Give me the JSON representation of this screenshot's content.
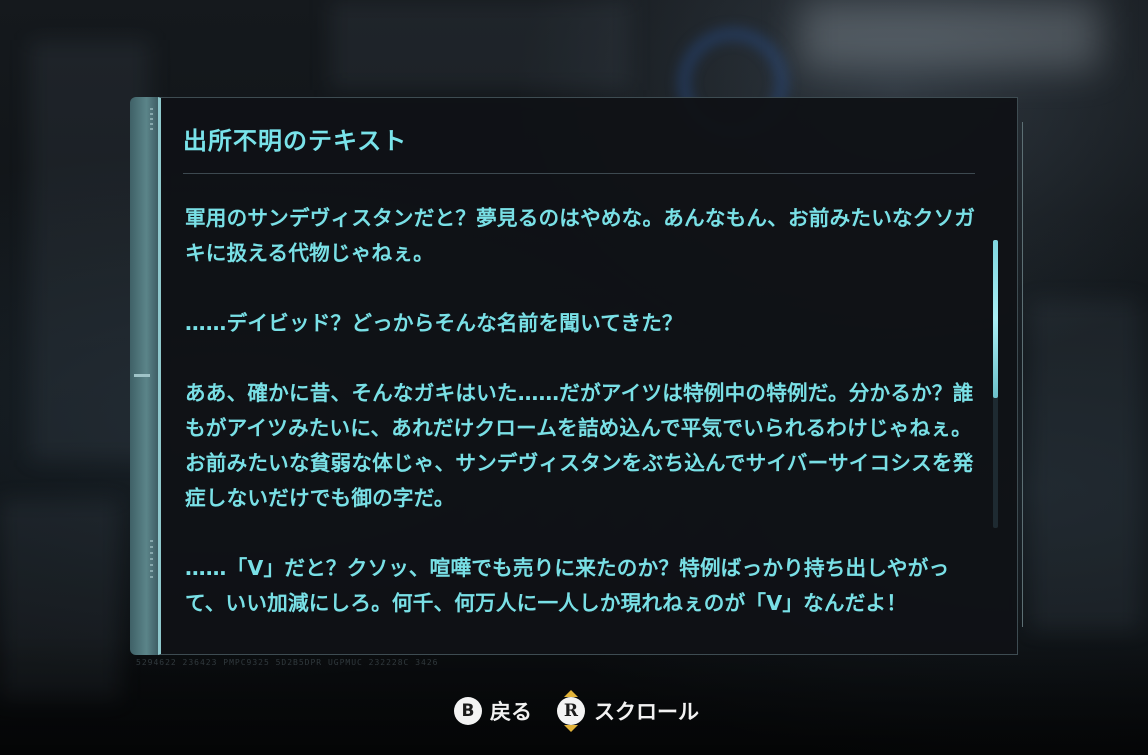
{
  "panel": {
    "title": "出所不明のテキスト",
    "paragraphs": [
      "軍用のサンデヴィスタンだと？夢見るのはやめな。あんなもん、お前みたいなクソガキに扱える代物じゃねぇ。",
      "……デイビッド？どっからそんな名前を聞いてきた？",
      "ああ、確かに昔、そんなガキはいた……だがアイツは特例中の特例だ。分かるか？誰もがアイツみたいに、あれだけクロームを詰め込んで平気でいられるわけじゃねぇ。お前みたいな貧弱な体じゃ、サンデヴィスタンをぶち込んでサイバーサイコシスを発症しないだけでも御の字だ。",
      "……「V」だと？クソッ、喧嘩でも売りに来たのか？特例ばっかり持ち出しやがって、いい加減にしろ。何千、何万人に一人しか現れねぇのが「V」なんだよ！"
    ],
    "scroll_position": 0.0,
    "scroll_visible_fraction": 0.55,
    "accent_color": "#79e3ea",
    "serial": "5294622 236423 PMPC9325 5D2B5DPR UGPMUC 232228C 3426"
  },
  "controls": {
    "back": {
      "key": "B",
      "label": "戻る"
    },
    "scroll": {
      "key": "R",
      "label": "スクロール"
    }
  }
}
